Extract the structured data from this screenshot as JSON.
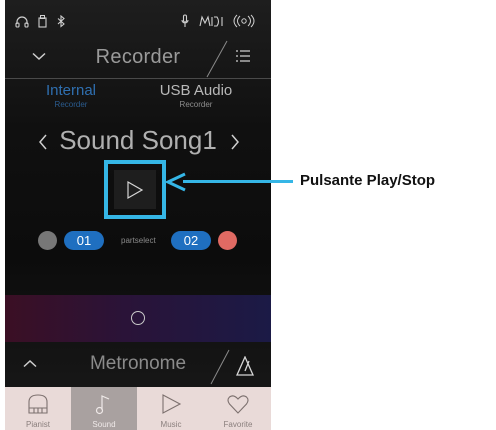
{
  "header": {
    "title": "Recorder"
  },
  "tabs": [
    {
      "label": "Internal",
      "sub": "Recorder"
    },
    {
      "label": "USB Audio",
      "sub": "Recorder"
    }
  ],
  "song": {
    "name": "Sound Song1"
  },
  "parts": {
    "part1": "01",
    "part2": "02",
    "select_label": "partselect"
  },
  "metronome": {
    "title": "Metronome"
  },
  "nav": [
    {
      "label": "Pianist",
      "icon": "piano-icon"
    },
    {
      "label": "Sound",
      "icon": "music-note-icon"
    },
    {
      "label": "Music",
      "icon": "play-triangle-icon"
    },
    {
      "label": "Favorite",
      "icon": "heart-icon"
    }
  ],
  "callout": {
    "label": "Pulsante Play/Stop"
  },
  "colors": {
    "accent": "#35b6e6",
    "part_blue": "#1f6fc0",
    "part1_dot": "#777777",
    "part2_dot": "#e06a63",
    "tab_active": "#2f6fb0",
    "nav_bg": "#e9dad8"
  }
}
